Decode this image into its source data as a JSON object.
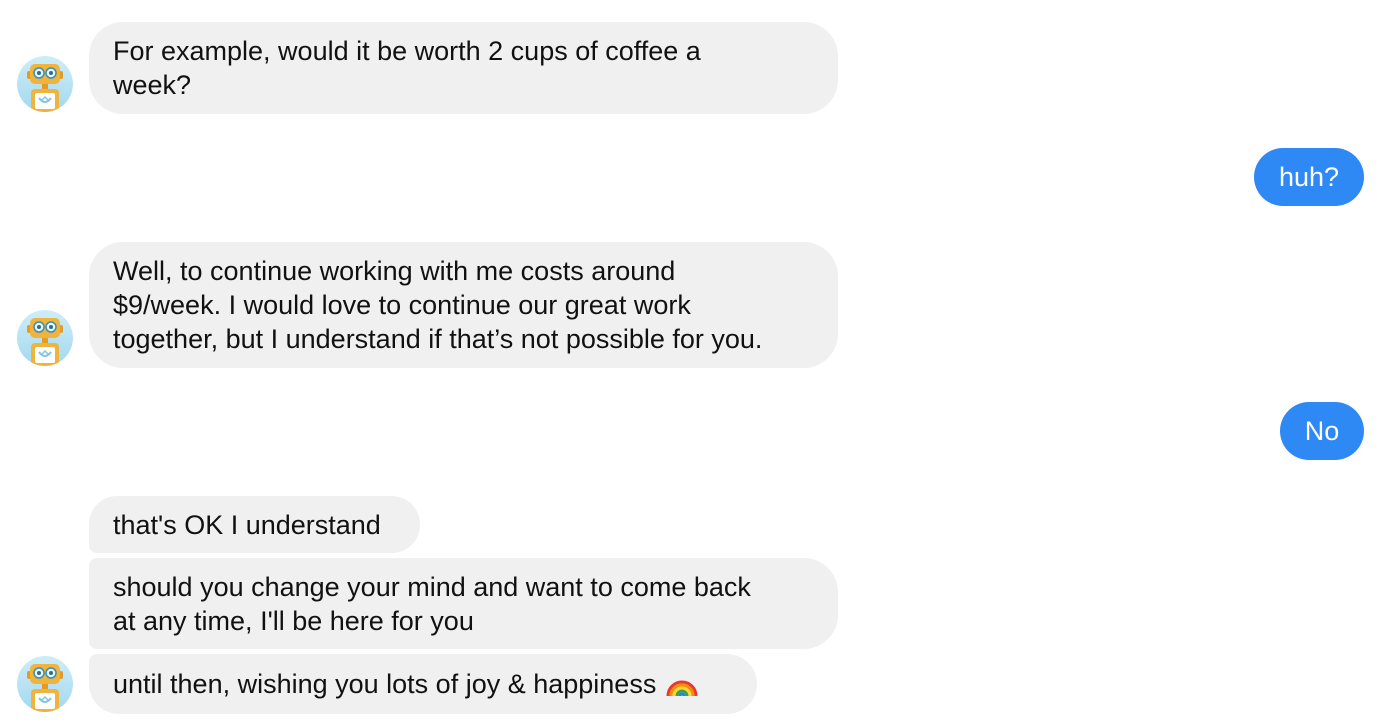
{
  "conversation": {
    "bot": {
      "avatar_icon": "robot-avatar-icon",
      "colors": {
        "bubble_in": "#f0f0f0",
        "avatar_bg": "#bfe6f5",
        "robot_body": "#f0b43c"
      }
    },
    "user": {
      "colors": {
        "bubble_out": "#2e89f5",
        "bubble_text": "#ffffff"
      }
    },
    "messages": [
      {
        "sender": "bot",
        "lines": [
          "For example, would it be worth 2 cups of coffee a",
          "week?"
        ]
      },
      {
        "sender": "user",
        "text": "huh?"
      },
      {
        "sender": "bot",
        "lines": [
          "Well, to continue working with me costs around",
          "$9/week. I would love to continue our great work",
          "together, but I understand if that’s not possible for you."
        ]
      },
      {
        "sender": "user",
        "text": "No"
      },
      {
        "sender": "bot",
        "lines": [
          "that's OK I understand"
        ]
      },
      {
        "sender": "bot",
        "lines": [
          "should you change your mind and want to come back",
          "at any time, I'll be here for you"
        ]
      },
      {
        "sender": "bot",
        "lines": [
          "until then, wishing you lots of joy & happiness"
        ],
        "emoji": "🌈",
        "emoji_icon": "rainbow-icon"
      }
    ]
  }
}
